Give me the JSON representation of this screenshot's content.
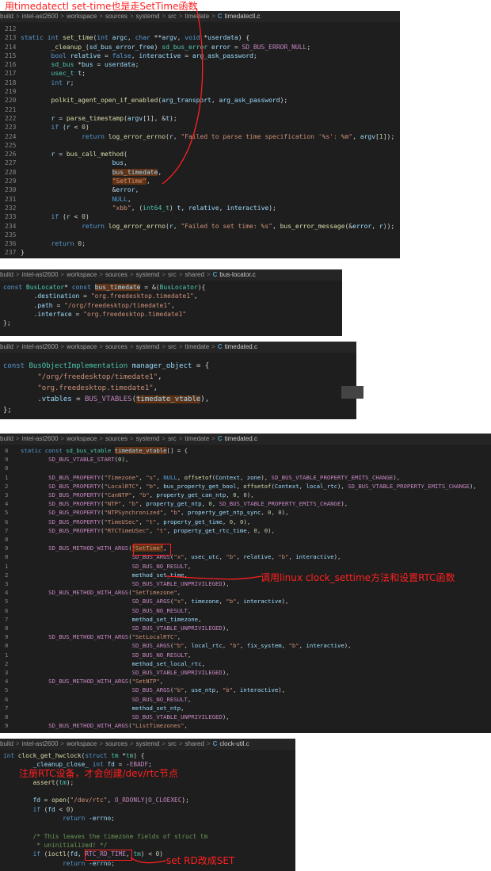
{
  "annotations": {
    "top": "用timedatectl set-time也是走SetTime函数",
    "clock_settime": "调用linux clock_settime方法和设置RTC函数",
    "rtc_register": "注册RTC设备，才会创建/dev/rtc节点",
    "rd_to_set": "set RD改成SET"
  },
  "panel1": {
    "breadcrumb": [
      "build",
      "intel-ast2600",
      "workspace",
      "sources",
      "systemd",
      "src",
      "timedate",
      "timedatectl.c"
    ],
    "lines": [
      [
        "212",
        ""
      ],
      [
        "213",
        "static int set_time(int argc, char **argv, void *userdata) {"
      ],
      [
        "214",
        "        _cleanup_(sd_bus_error_free) sd_bus_error error = SD_BUS_ERROR_NULL;"
      ],
      [
        "215",
        "        bool relative = false, interactive = arg_ask_password;"
      ],
      [
        "216",
        "        sd_bus *bus = userdata;"
      ],
      [
        "217",
        "        usec_t t;"
      ],
      [
        "218",
        "        int r;"
      ],
      [
        "219",
        ""
      ],
      [
        "220",
        "        polkit_agent_open_if_enabled(arg_transport, arg_ask_password);"
      ],
      [
        "221",
        ""
      ],
      [
        "222",
        "        r = parse_timestamp(argv[1], &t);"
      ],
      [
        "223",
        "        if (r < 0)"
      ],
      [
        "224",
        "                return log_error_errno(r, \"Failed to parse time specification '%s': %m\", argv[1]);"
      ],
      [
        "225",
        ""
      ],
      [
        "226",
        "        r = bus_call_method("
      ],
      [
        "227",
        "                        bus,"
      ],
      [
        "228",
        "                        bus_timedate,"
      ],
      [
        "229",
        "                        \"SetTime\","
      ],
      [
        "230",
        "                        &error,"
      ],
      [
        "231",
        "                        NULL,"
      ],
      [
        "232",
        "                        \"xbb\", (int64_t) t, relative, interactive);"
      ],
      [
        "233",
        "        if (r < 0)"
      ],
      [
        "234",
        "                return log_error_errno(r, \"Failed to set time: %s\", bus_error_message(&error, r));"
      ],
      [
        "235",
        ""
      ],
      [
        "236",
        "        return 0;"
      ],
      [
        "237",
        "}"
      ]
    ]
  },
  "panel2": {
    "breadcrumb": [
      "build",
      "intel-ast2600",
      "workspace",
      "sources",
      "systemd",
      "src",
      "shared",
      "bus-locator.c"
    ],
    "lines": [
      [
        "",
        "const BusLocator* const bus_timedate = &(BusLocator){"
      ],
      [
        "",
        "        .destination = \"org.freedesktop.timedate1\","
      ],
      [
        "",
        "        .path = \"/org/freedesktop/timedate1\","
      ],
      [
        "",
        "        .interface = \"org.freedesktop.timedate1\""
      ],
      [
        "",
        "};"
      ]
    ]
  },
  "panel3": {
    "breadcrumb": [
      "build",
      "intel-ast2600",
      "workspace",
      "sources",
      "systemd",
      "src",
      "timedate",
      "timedated.c"
    ],
    "lines": [
      [
        "",
        "const BusObjectImplementation manager_object = {"
      ],
      [
        "",
        "        \"/org/freedesktop/timedate1\","
      ],
      [
        "",
        "        \"org.freedesktop.timedate1\","
      ],
      [
        "",
        "        .vtables = BUS_VTABLES(timedate_vtable),"
      ],
      [
        "",
        "};"
      ]
    ]
  },
  "panel4": {
    "breadcrumb": [
      "build",
      "intel-ast2600",
      "workspace",
      "sources",
      "systemd",
      "src",
      "timedate",
      "timedated.c"
    ],
    "lines": [
      [
        "8",
        "static const sd_bus_vtable timedate_vtable[] = {"
      ],
      [
        "9",
        "        SD_BUS_VTABLE_START(0),"
      ],
      [
        "0",
        ""
      ],
      [
        "1",
        "        SD_BUS_PROPERTY(\"Timezone\", \"s\", NULL, offsetof(Context, zone), SD_BUS_VTABLE_PROPERTY_EMITS_CHANGE),"
      ],
      [
        "2",
        "        SD_BUS_PROPERTY(\"LocalRTC\", \"b\", bus_property_get_bool, offsetof(Context, local_rtc), SD_BUS_VTABLE_PROPERTY_EMITS_CHANGE),"
      ],
      [
        "3",
        "        SD_BUS_PROPERTY(\"CanNTP\", \"b\", property_get_can_ntp, 0, 0),"
      ],
      [
        "4",
        "        SD_BUS_PROPERTY(\"NTP\", \"b\", property_get_ntp, 0, SD_BUS_VTABLE_PROPERTY_EMITS_CHANGE),"
      ],
      [
        "5",
        "        SD_BUS_PROPERTY(\"NTPSynchronized\", \"b\", property_get_ntp_sync, 0, 0),"
      ],
      [
        "6",
        "        SD_BUS_PROPERTY(\"TimeUSec\", \"t\", property_get_time, 0, 0),"
      ],
      [
        "7",
        "        SD_BUS_PROPERTY(\"RTCTimeUSec\", \"t\", property_get_rtc_time, 0, 0),"
      ],
      [
        "8",
        ""
      ],
      [
        "9",
        "        SD_BUS_METHOD_WITH_ARGS(\"SetTime\","
      ],
      [
        "0",
        "                                SD_BUS_ARGS(\"x\", usec_utc, \"b\", relative, \"b\", interactive),"
      ],
      [
        "1",
        "                                SD_BUS_NO_RESULT,"
      ],
      [
        "2",
        "                                method_set_time,"
      ],
      [
        "3",
        "                                SD_BUS_VTABLE_UNPRIVILEGED),"
      ],
      [
        "4",
        "        SD_BUS_METHOD_WITH_ARGS(\"SetTimezone\","
      ],
      [
        "5",
        "                                SD_BUS_ARGS(\"s\", timezone, \"b\", interactive),"
      ],
      [
        "6",
        "                                SD_BUS_NO_RESULT,"
      ],
      [
        "7",
        "                                method_set_timezone,"
      ],
      [
        "8",
        "                                SD_BUS_VTABLE_UNPRIVILEGED),"
      ],
      [
        "9",
        "        SD_BUS_METHOD_WITH_ARGS(\"SetLocalRTC\","
      ],
      [
        "0",
        "                                SD_BUS_ARGS(\"b\", local_rtc, \"b\", fix_system, \"b\", interactive),"
      ],
      [
        "1",
        "                                SD_BUS_NO_RESULT,"
      ],
      [
        "2",
        "                                method_set_local_rtc,"
      ],
      [
        "3",
        "                                SD_BUS_VTABLE_UNPRIVILEGED),"
      ],
      [
        "4",
        "        SD_BUS_METHOD_WITH_ARGS(\"SetNTP\","
      ],
      [
        "5",
        "                                SD_BUS_ARGS(\"b\", use_ntp, \"b\", interactive),"
      ],
      [
        "6",
        "                                SD_BUS_NO_RESULT,"
      ],
      [
        "7",
        "                                method_set_ntp,"
      ],
      [
        "8",
        "                                SD_BUS_VTABLE_UNPRIVILEGED),"
      ],
      [
        "9",
        "        SD_BUS_METHOD_WITH_ARGS(\"ListTimezones\","
      ]
    ]
  },
  "panel5": {
    "breadcrumb": [
      "build",
      "intel-ast2600",
      "workspace",
      "sources",
      "systemd",
      "src",
      "shared",
      "clock-util.c"
    ],
    "lines": [
      [
        "",
        "int clock_get_hwclock(struct tm *tm) {"
      ],
      [
        "",
        "        _cleanup_close_ int fd = -EBADF;"
      ],
      [
        "",
        ""
      ],
      [
        "",
        "        assert(tm);"
      ],
      [
        "",
        ""
      ],
      [
        "",
        "        fd = open(\"/dev/rtc\", O_RDONLY|O_CLOEXEC);"
      ],
      [
        "",
        "        if (fd < 0)"
      ],
      [
        "",
        "                return -errno;"
      ],
      [
        "",
        ""
      ],
      [
        "",
        "        /* This leaves the timezone fields of struct tm"
      ],
      [
        "",
        "         * uninitialized! */"
      ],
      [
        "",
        "        if (ioctl(fd, RTC_RD_TIME, tm) < 0)"
      ],
      [
        "",
        "                return -errno;"
      ]
    ]
  }
}
